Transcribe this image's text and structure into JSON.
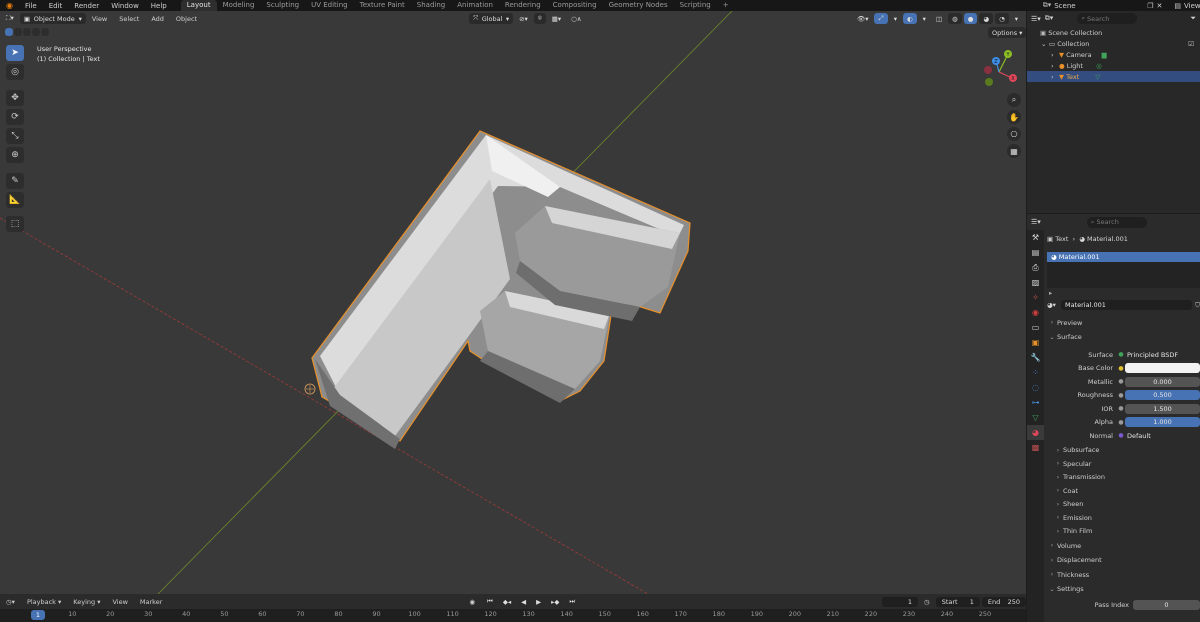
{
  "menu": {
    "items": [
      "File",
      "Edit",
      "Render",
      "Window",
      "Help"
    ],
    "workspaces": [
      "Layout",
      "Modeling",
      "Sculpting",
      "UV Editing",
      "Texture Paint",
      "Shading",
      "Animation",
      "Rendering",
      "Compositing",
      "Geometry Nodes",
      "Scripting"
    ],
    "active_workspace": "Layout",
    "add_tab": "+",
    "scene": "Scene",
    "view_layer": "ViewLayer"
  },
  "viewport": {
    "mode": "Object Mode",
    "menus": [
      "View",
      "Select",
      "Add",
      "Object"
    ],
    "transform_orientation": "Global",
    "options_label": "Options",
    "info_line1": "User Perspective",
    "info_line2": "(1) Collection | Text",
    "gizmo": {
      "y": "Y",
      "z": "Z",
      "x": "X"
    }
  },
  "outliner": {
    "search_placeholder": "Search",
    "scene_collection": "Scene Collection",
    "collection": "Collection",
    "objects": [
      {
        "name": "Camera",
        "selected": false
      },
      {
        "name": "Light",
        "selected": false
      },
      {
        "name": "Text",
        "selected": true
      }
    ]
  },
  "properties": {
    "search_placeholder": "Search",
    "breadcrumb_object": "Text",
    "breadcrumb_material": "Material.001",
    "slot_name": "Material.001",
    "material_name": "Material.001",
    "sections": {
      "preview": "Preview",
      "surface": "Surface",
      "volume": "Volume",
      "displacement": "Displacement",
      "thickness": "Thickness",
      "settings": "Settings"
    },
    "surface_fields": [
      {
        "label": "Surface",
        "value": "Principled BSDF",
        "style": "plain",
        "dot": "green"
      },
      {
        "label": "Base Color",
        "value": "",
        "style": "white",
        "dot": "yellow"
      },
      {
        "label": "Metallic",
        "value": "0.000",
        "style": "grey",
        "dot": "grey"
      },
      {
        "label": "Roughness",
        "value": "0.500",
        "style": "blue",
        "dot": "grey"
      },
      {
        "label": "IOR",
        "value": "1.500",
        "style": "grey",
        "dot": "grey"
      },
      {
        "label": "Alpha",
        "value": "1.000",
        "style": "blue",
        "dot": "grey"
      },
      {
        "label": "Normal",
        "value": "Default",
        "style": "plain",
        "dot": "purple"
      }
    ],
    "subsections": [
      "Subsurface",
      "Specular",
      "Transmission",
      "Coat",
      "Sheen",
      "Emission",
      "Thin Film"
    ],
    "pass_index_label": "Pass Index",
    "pass_index_value": "0"
  },
  "timeline": {
    "menus": [
      "Playback",
      "Keying",
      "View",
      "Marker"
    ],
    "current_frame": "1",
    "start_label": "Start",
    "start_value": "1",
    "end_label": "End",
    "end_value": "250",
    "ticks": [
      "1",
      "10",
      "20",
      "30",
      "40",
      "50",
      "60",
      "70",
      "80",
      "90",
      "100",
      "110",
      "120",
      "130",
      "140",
      "150",
      "160",
      "170",
      "180",
      "190",
      "200",
      "210",
      "220",
      "230",
      "240",
      "250"
    ]
  },
  "colors": {
    "accent": "#4772b3",
    "selection_outline": "#e8902a",
    "axis_x": "#c0392b",
    "axis_y": "#7a9a2a",
    "gizmo_x": "#e0485a",
    "gizmo_y": "#8cbf26",
    "gizmo_z": "#3e8fe8"
  }
}
